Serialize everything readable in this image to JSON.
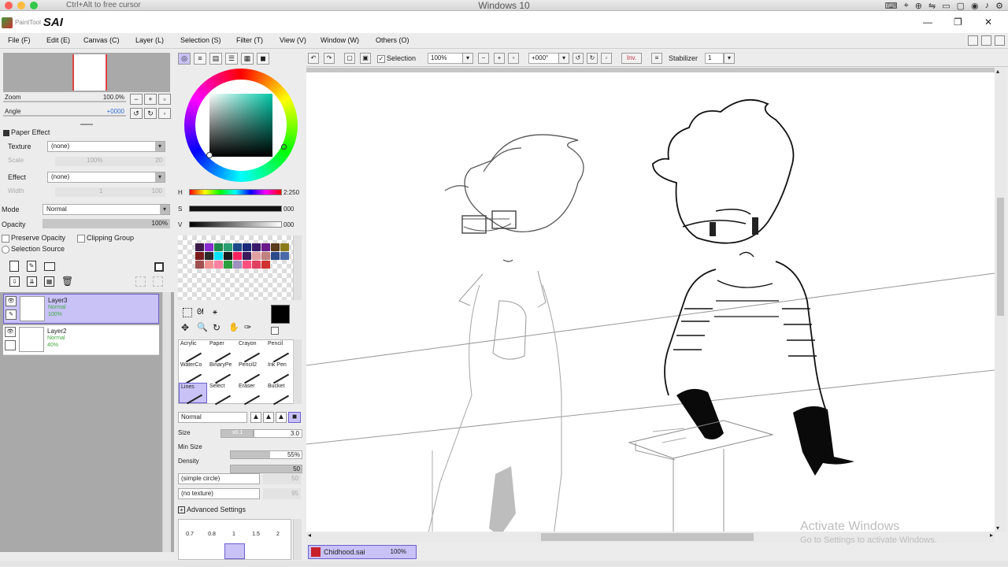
{
  "host": {
    "hint": "Ctrl+Alt to free cursor",
    "title": "Windows 10"
  },
  "app": {
    "brand_small": "PaintTool",
    "brand_big": "SAI"
  },
  "menu": [
    "File (F)",
    "Edit (E)",
    "Canvas (C)",
    "Layer (L)",
    "Selection (S)",
    "Filter (T)",
    "View (V)",
    "Window (W)",
    "Others (O)"
  ],
  "navigator": {
    "zoom_label": "Zoom",
    "zoom_value": "100.0%",
    "angle_label": "Angle",
    "angle_value": "+0000"
  },
  "paper_effect": {
    "header": "Paper Effect",
    "texture_label": "Texture",
    "texture_value": "(none)",
    "scale_label": "Scale",
    "scale_value": "100%",
    "scale_num": "20",
    "effect_label": "Effect",
    "effect_value": "(none)",
    "width_label": "Width",
    "width_value": "1",
    "width_num": "100"
  },
  "layer_props": {
    "mode_label": "Mode",
    "mode_value": "Normal",
    "opacity_label": "Opacity",
    "opacity_value": "100%",
    "preserve_opacity": "Preserve Opacity",
    "clipping_group": "Clipping Group",
    "selection_source": "Selection Source"
  },
  "layers": [
    {
      "name": "Layer3",
      "mode": "Normal",
      "opacity": "100%",
      "selected": true
    },
    {
      "name": "Layer2",
      "mode": "Normal",
      "opacity": "40%",
      "selected": false
    }
  ],
  "color": {
    "h_label": "H",
    "h_value": "2:250",
    "s_label": "S",
    "s_value": "000",
    "v_label": "V",
    "v_value": "000",
    "swatches": [
      "#3c1a4a",
      "#8a2bd0",
      "#1e8a4a",
      "#2aa070",
      "#1a4a8a",
      "#1a2a7a",
      "#3a1a6a",
      "#6a1a8a",
      "#5a3a1a",
      "#8a7a1a",
      "#7a1a1a",
      "#2a2a2a",
      "#00e0ff",
      "#1a1a1a",
      "#ff2060",
      "#3a1a5a",
      "#e0a0a0",
      "#c08080",
      "#2a4a8a",
      "#4a6aaa",
      "#a05050",
      "#f09090",
      "#ff80a0",
      "#2aa040",
      "#a090c0",
      "#ff5080",
      "#e04060",
      "#d03030"
    ]
  },
  "tools": [
    {
      "label": "Acrylic",
      "selected": false
    },
    {
      "label": "Paper",
      "selected": false
    },
    {
      "label": "Crayon",
      "selected": false
    },
    {
      "label": "Pencil",
      "selected": false
    },
    {
      "label": "WaterCo",
      "selected": false
    },
    {
      "label": "BinaryPe",
      "selected": false
    },
    {
      "label": "Pencil2",
      "selected": false
    },
    {
      "label": "Ink Pen",
      "selected": false
    },
    {
      "label": "Lines",
      "selected": true
    },
    {
      "label": "Select",
      "selected": false
    },
    {
      "label": "Eraser",
      "selected": false
    },
    {
      "label": "Bucket",
      "selected": false
    }
  ],
  "brush": {
    "mode_value": "Normal",
    "size_label": "Size",
    "size_multiplier": "x0.1",
    "size_value": "3.0",
    "minsize_label": "Min Size",
    "minsize_value": "55%",
    "minsize_pct": 0.55,
    "density_label": "Density",
    "density_value": "50",
    "density_pct": 1.0,
    "shape_value": "(simple circle)",
    "shape_num": "50",
    "texture_value": "(no texture)",
    "texture_num": "95",
    "advanced_label": "Advanced Settings",
    "sizes": [
      "0.7",
      "0.8",
      "1",
      "1.5",
      "2"
    ]
  },
  "canvas_toolbar": {
    "selection_label": "Selection",
    "zoom_value": "100%",
    "angle_value": "+000°",
    "inv_label": "Inv.",
    "stabilizer_label": "Stabilizer",
    "stabilizer_value": "1"
  },
  "document": {
    "name": "Chidhood.sai",
    "zoom": "100%"
  },
  "watermark": {
    "line1": "Activate Windows",
    "line2": "Go to Settings to activate Windows."
  },
  "colors": {
    "accent_bg": "#c8c2f6",
    "accent_border": "#6a5fd0",
    "panel_bg": "#ececec"
  }
}
